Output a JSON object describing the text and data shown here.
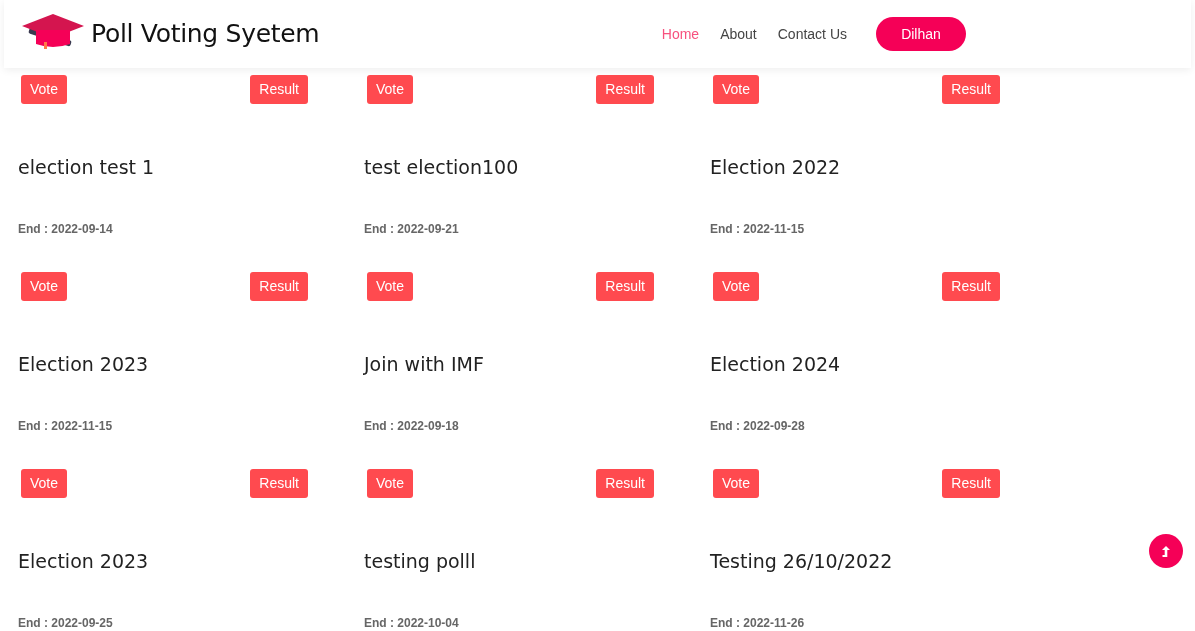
{
  "header": {
    "title": "Poll Voting Syetem",
    "nav": [
      {
        "label": "Home",
        "selected": true
      },
      {
        "label": "About",
        "selected": false
      },
      {
        "label": "Contact Us",
        "selected": false
      }
    ],
    "user_button": "Dilhan"
  },
  "polls": [
    {
      "vote": "Vote",
      "result": "Result",
      "title": "election test 1",
      "end": "End : 2022-09-14"
    },
    {
      "vote": "Vote",
      "result": "Result",
      "title": "test election100",
      "end": "End : 2022-09-21"
    },
    {
      "vote": "Vote",
      "result": "Result",
      "title": "Election 2022",
      "end": "End : 2022-11-15"
    },
    {
      "vote": "Vote",
      "result": "Result",
      "title": "Election 2023",
      "end": "End : 2022-11-15"
    },
    {
      "vote": "Vote",
      "result": "Result",
      "title": "Join with IMF",
      "end": "End : 2022-09-18"
    },
    {
      "vote": "Vote",
      "result": "Result",
      "title": "Election 2024",
      "end": "End : 2022-09-28"
    },
    {
      "vote": "Vote",
      "result": "Result",
      "title": "Election 2023",
      "end": "End : 2022-09-25"
    },
    {
      "vote": "Vote",
      "result": "Result",
      "title": "testing polll",
      "end": "End : 2022-10-04"
    },
    {
      "vote": "Vote",
      "result": "Result",
      "title": "Testing 26/10/2022",
      "end": "End : 2022-11-26"
    }
  ]
}
